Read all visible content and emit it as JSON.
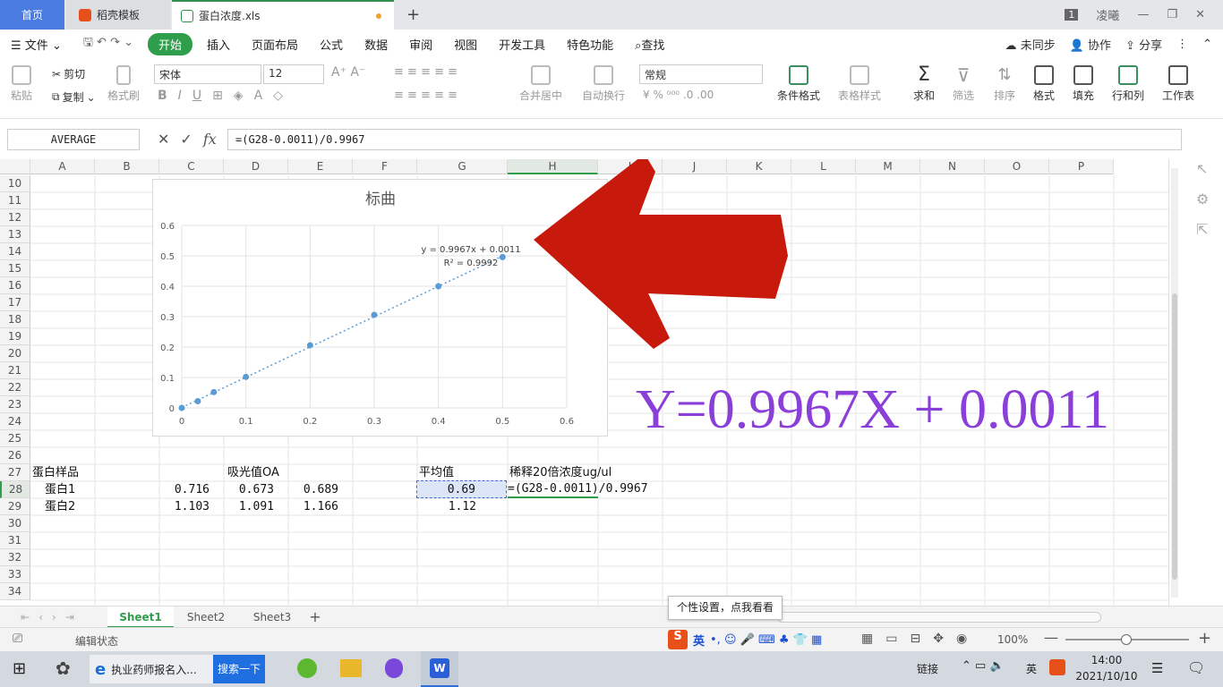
{
  "tabs": {
    "home": "首页",
    "template": "稻壳模板",
    "file": "蛋白浓度.xls",
    "add": "+",
    "badge": "1",
    "user": "凌曦"
  },
  "menu": {
    "file": "文件",
    "items": [
      "开始",
      "插入",
      "页面布局",
      "公式",
      "数据",
      "审阅",
      "视图",
      "开发工具",
      "特色功能"
    ],
    "search": "查找",
    "right": [
      "未同步",
      "协作",
      "分享"
    ]
  },
  "ribbon": {
    "paste": "粘贴",
    "cut": "剪切",
    "copy": "复制",
    "format_painter": "格式刷",
    "font": "宋体",
    "size": "12",
    "number_format": "常规",
    "merge": "合并居中",
    "wrap": "自动换行",
    "cond_format": "条件格式",
    "table_style": "表格样式",
    "sum": "求和",
    "filter": "筛选",
    "sort": "排序",
    "format": "格式",
    "fill": "填充",
    "rowcol": "行和列",
    "sheet": "工作表"
  },
  "formula_bar": {
    "name_box": "AVERAGE",
    "fx": "fx",
    "formula": "=(G28-0.0011)/0.9967"
  },
  "columns": [
    "A",
    "B",
    "C",
    "D",
    "E",
    "F",
    "G",
    "H",
    "I",
    "J",
    "K",
    "L",
    "M",
    "N",
    "O",
    "P"
  ],
  "rows": [
    "10",
    "11",
    "12",
    "13",
    "14",
    "15",
    "16",
    "17",
    "18",
    "19",
    "20",
    "21",
    "22",
    "23",
    "24",
    "25",
    "26",
    "27",
    "28",
    "29",
    "30",
    "31",
    "32",
    "33",
    "34"
  ],
  "cells": {
    "a27": "蛋白样品",
    "d27": "吸光值OA",
    "g27": "平均值",
    "h27": "稀释20倍浓度ug/ul",
    "a28": "蛋白1",
    "c28": "0.716",
    "d28": "0.673",
    "e28": "0.689",
    "g28": "0.69",
    "h28": "=(G28-0.0011)/0.9967",
    "a29": "蛋白2",
    "c29": "1.103",
    "d29": "1.091",
    "e29": "1.166",
    "g29": "1.12"
  },
  "overlay_equation": "Y=0.9967X + 0.0011",
  "chart_data": {
    "type": "scatter",
    "title": "标曲",
    "x": [
      0,
      0.025,
      0.05,
      0.1,
      0.2,
      0.3,
      0.4,
      0.5
    ],
    "y": [
      0,
      0.022,
      0.052,
      0.102,
      0.206,
      0.306,
      0.4,
      0.496
    ],
    "trendline": {
      "slope": 0.9967,
      "intercept": 0.0011
    },
    "equation_label": "y = 0.9967x + 0.0011",
    "r2_label": "R² = 0.9992",
    "xlim": [
      0,
      0.6
    ],
    "ylim": [
      0,
      0.6
    ],
    "xticks": [
      "0",
      "0.1",
      "0.2",
      "0.3",
      "0.4",
      "0.5",
      "0.6"
    ],
    "yticks": [
      "0",
      "0.1",
      "0.2",
      "0.3",
      "0.4",
      "0.5",
      "0.6"
    ],
    "grid": true,
    "point_color": "#5b9bd5"
  },
  "sheets": [
    "Sheet1",
    "Sheet2",
    "Sheet3"
  ],
  "status": {
    "mode": "编辑状态",
    "tooltip": "个性设置，点我看看",
    "ime": "英",
    "zoom": "100%"
  },
  "taskbar": {
    "browser_tab": "执业药师报名入...",
    "search_btn": "搜索一下",
    "link": "链接",
    "lang": "英",
    "time": "14:00",
    "date": "2021/10/10"
  },
  "colors": {
    "accent": "#2e9d4c",
    "home_tab": "#4a7be0",
    "overlay_text": "#8a3fd8",
    "arrow": "#c81a0c"
  }
}
